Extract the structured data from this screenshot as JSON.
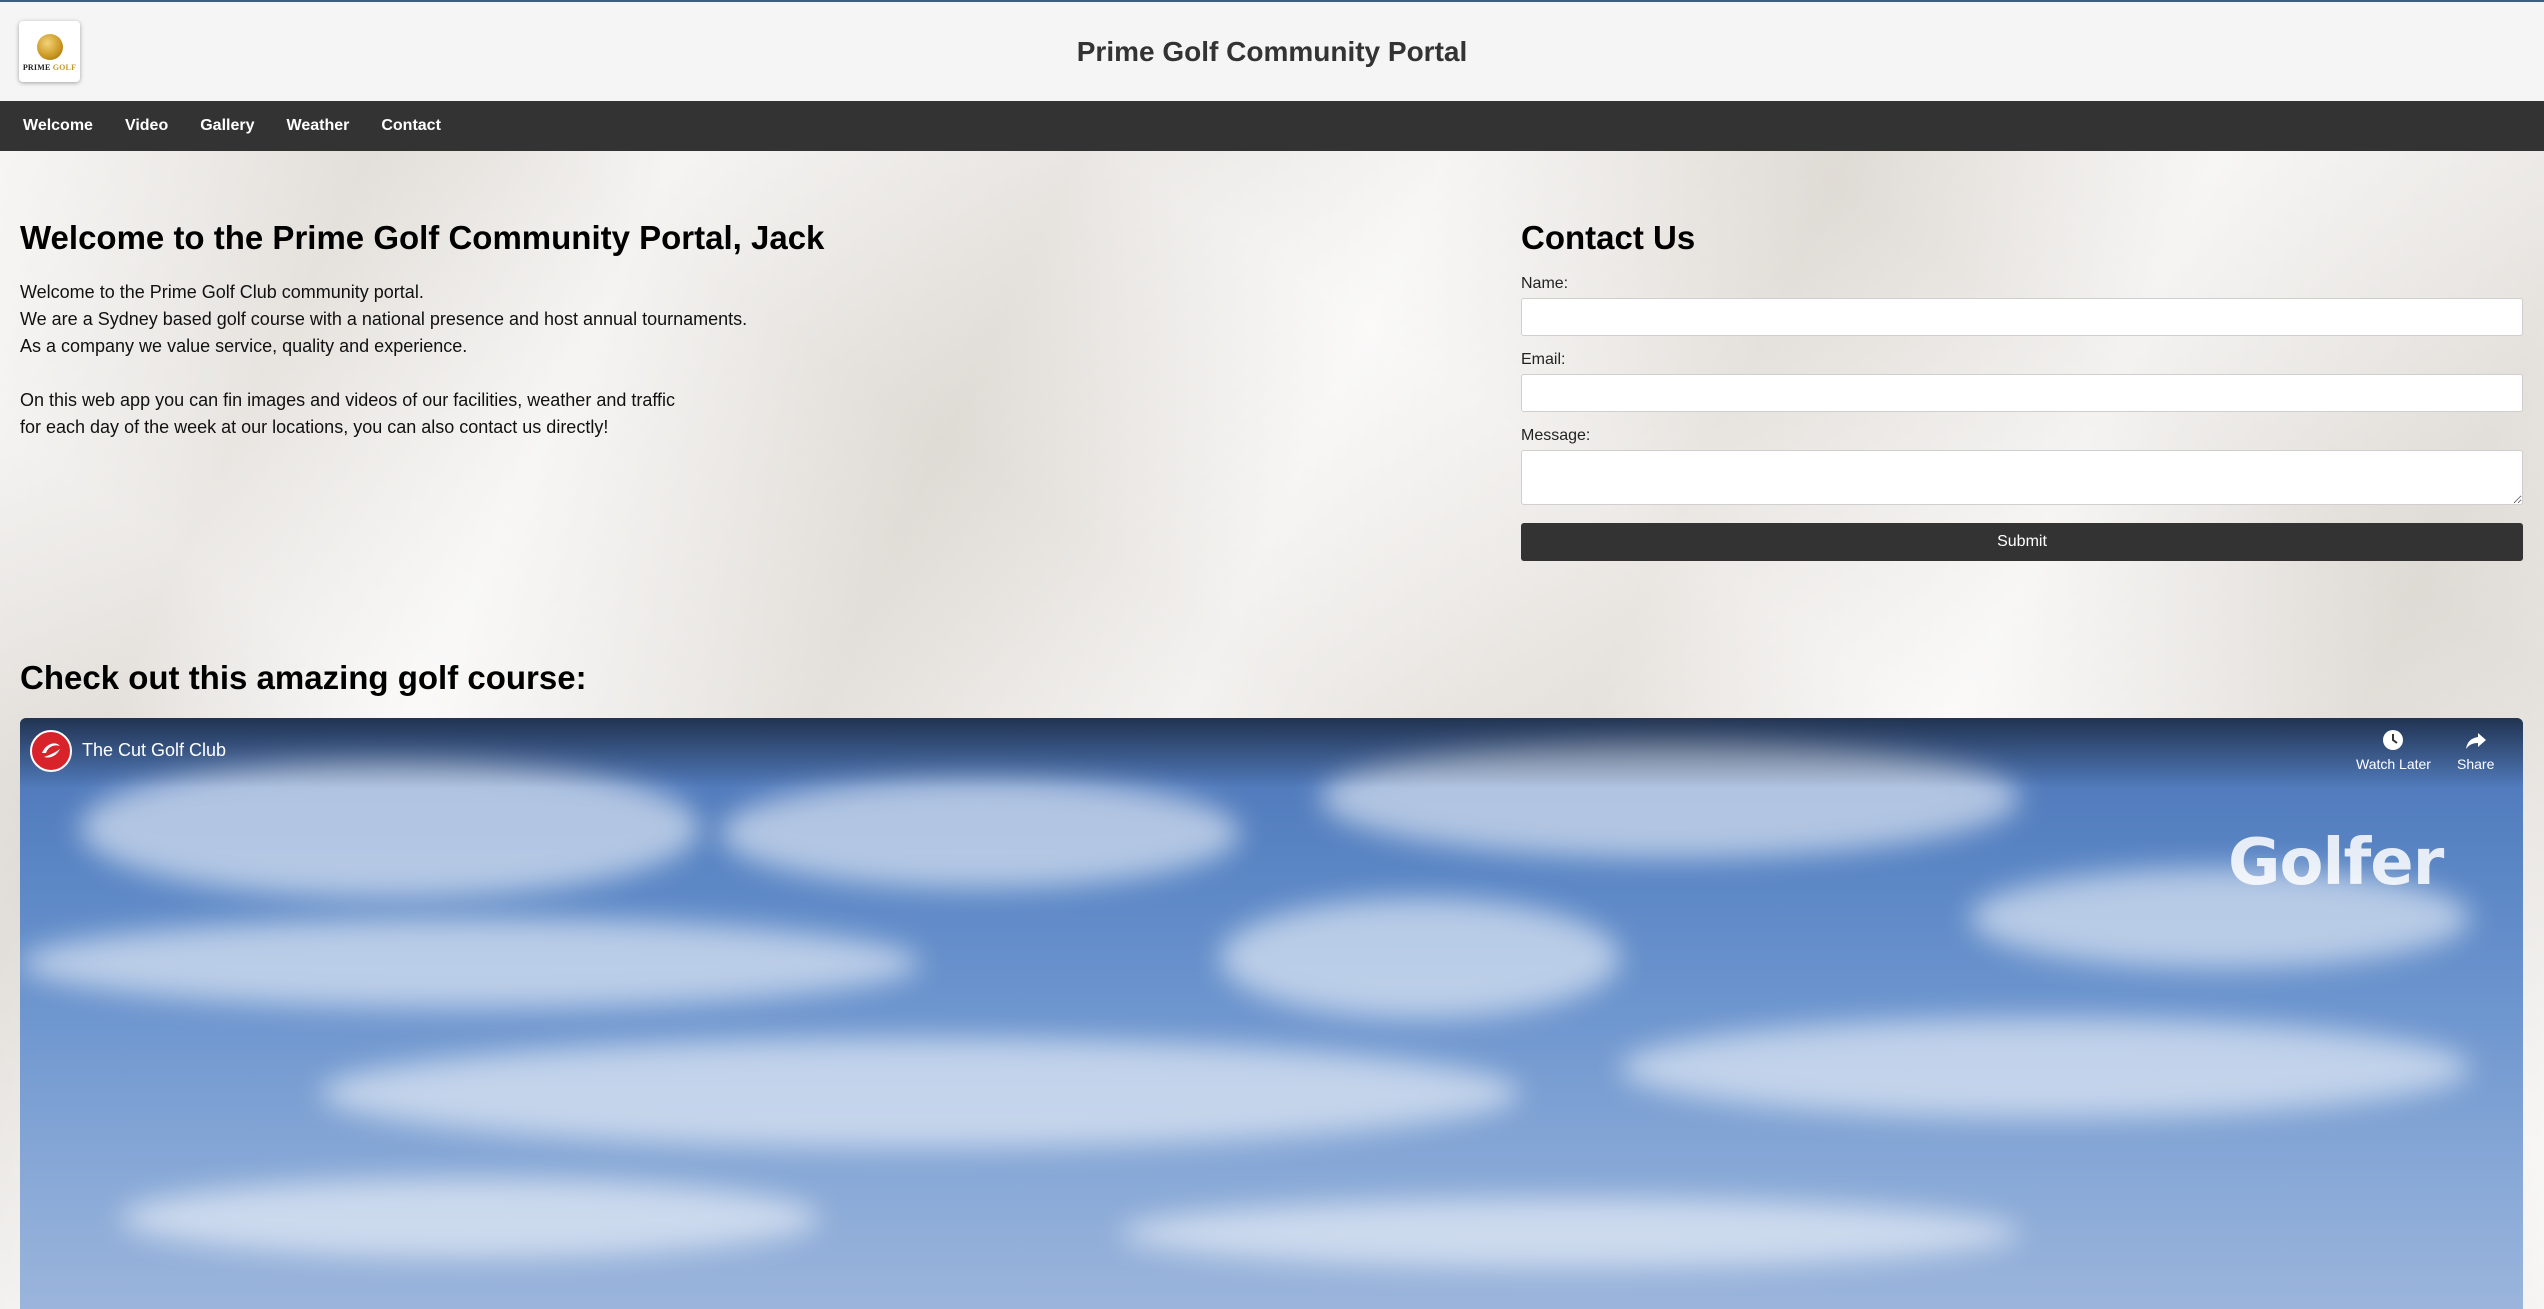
{
  "header": {
    "title": "Prime Golf Community Portal",
    "logo_text_a": "PRIME",
    "logo_text_b": "GOLF"
  },
  "nav": {
    "items": [
      {
        "label": "Welcome"
      },
      {
        "label": "Video"
      },
      {
        "label": "Gallery"
      },
      {
        "label": "Weather"
      },
      {
        "label": "Contact"
      }
    ]
  },
  "welcome": {
    "heading": "Welcome to the Prime Golf Community Portal, Jack",
    "lines": [
      "Welcome to the Prime Golf Club community portal.",
      "We are a Sydney based golf course with a national presence and host annual tournaments.",
      "As a company we value service, quality and experience.",
      "On this web app you can fin images and videos of our facilities, weather and traffic",
      "for each day of the week at our locations, you can also contact us directly!"
    ]
  },
  "contact": {
    "heading": "Contact Us",
    "name_label": "Name:",
    "name_value": "",
    "email_label": "Email:",
    "email_value": "",
    "message_label": "Message:",
    "message_value": "",
    "submit_label": "Submit"
  },
  "video": {
    "heading": "Check out this amazing golf course:",
    "channel_title": "The Cut Golf Club",
    "watch_later_label": "Watch Later",
    "share_label": "Share",
    "watermark": "Golfer"
  },
  "colors": {
    "nav_bg": "#333333",
    "header_bg": "#f5f5f5",
    "channel_red": "#d8232a"
  }
}
